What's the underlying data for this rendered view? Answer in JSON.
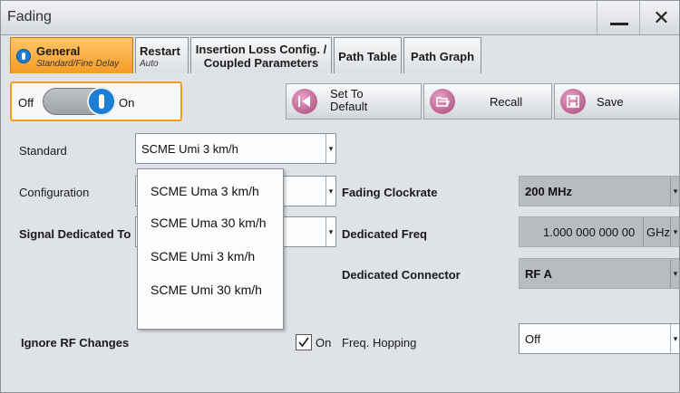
{
  "window": {
    "title": "Fading",
    "minimize_icon": "minimize-icon",
    "close_label": "✕"
  },
  "tabs": [
    {
      "label": "General",
      "sub": "Standard/Fine Delay",
      "active": true
    },
    {
      "label": "Restart",
      "sub": "Auto"
    },
    {
      "label": "Insertion Loss Config. /",
      "label2": "Coupled Parameters"
    },
    {
      "label": "Path Table"
    },
    {
      "label": "Path Graph"
    }
  ],
  "toolbar": {
    "off_label": "Off",
    "on_label": "On",
    "set_default_line1": "Set To",
    "set_default_line2": "Default",
    "recall_label": "Recall",
    "save_label": "Save"
  },
  "fields": {
    "standard_label": "Standard",
    "standard_value": "SCME Umi 3 km/h",
    "configuration_label": "Configuration",
    "signal_dedicated_label": "Signal Dedicated To",
    "fading_clockrate_label": "Fading Clockrate",
    "fading_clockrate_value": "200 MHz",
    "dedicated_freq_label": "Dedicated Freq",
    "dedicated_freq_value": "1.000 000 000 00",
    "dedicated_freq_unit": "GHz",
    "dedicated_connector_label": "Dedicated Connector",
    "dedicated_connector_value": "RF A",
    "ignore_rf_label": "Ignore RF Changes",
    "ignore_rf_check_label": "On",
    "freq_hopping_label": "Freq. Hopping",
    "freq_hopping_value": "Off"
  },
  "dropdown": {
    "options": [
      "SCME Uma 3 km/h",
      "SCME Uma 30 km/h",
      "SCME Umi 3 km/h",
      "SCME Umi 30 km/h"
    ]
  },
  "colors": {
    "accent": "#f59c23",
    "toggle_blue": "#1b7fd6",
    "icon_pink": "#a6467a"
  }
}
